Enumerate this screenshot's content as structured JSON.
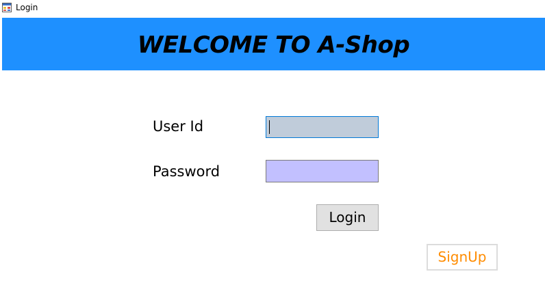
{
  "window": {
    "title": "Login",
    "icon": "windows-form-icon"
  },
  "banner": {
    "text": "WELCOME TO A-Shop",
    "background_color": "#1e90ff"
  },
  "form": {
    "userid_label": "User Id",
    "userid_value": "",
    "userid_bg": "#c0ccda",
    "password_label": "Password",
    "password_value": "",
    "password_bg": "#c2c0ff",
    "login_button_label": "Login",
    "signup_button_label": "SignUp",
    "signup_text_color": "#ff8c00"
  }
}
